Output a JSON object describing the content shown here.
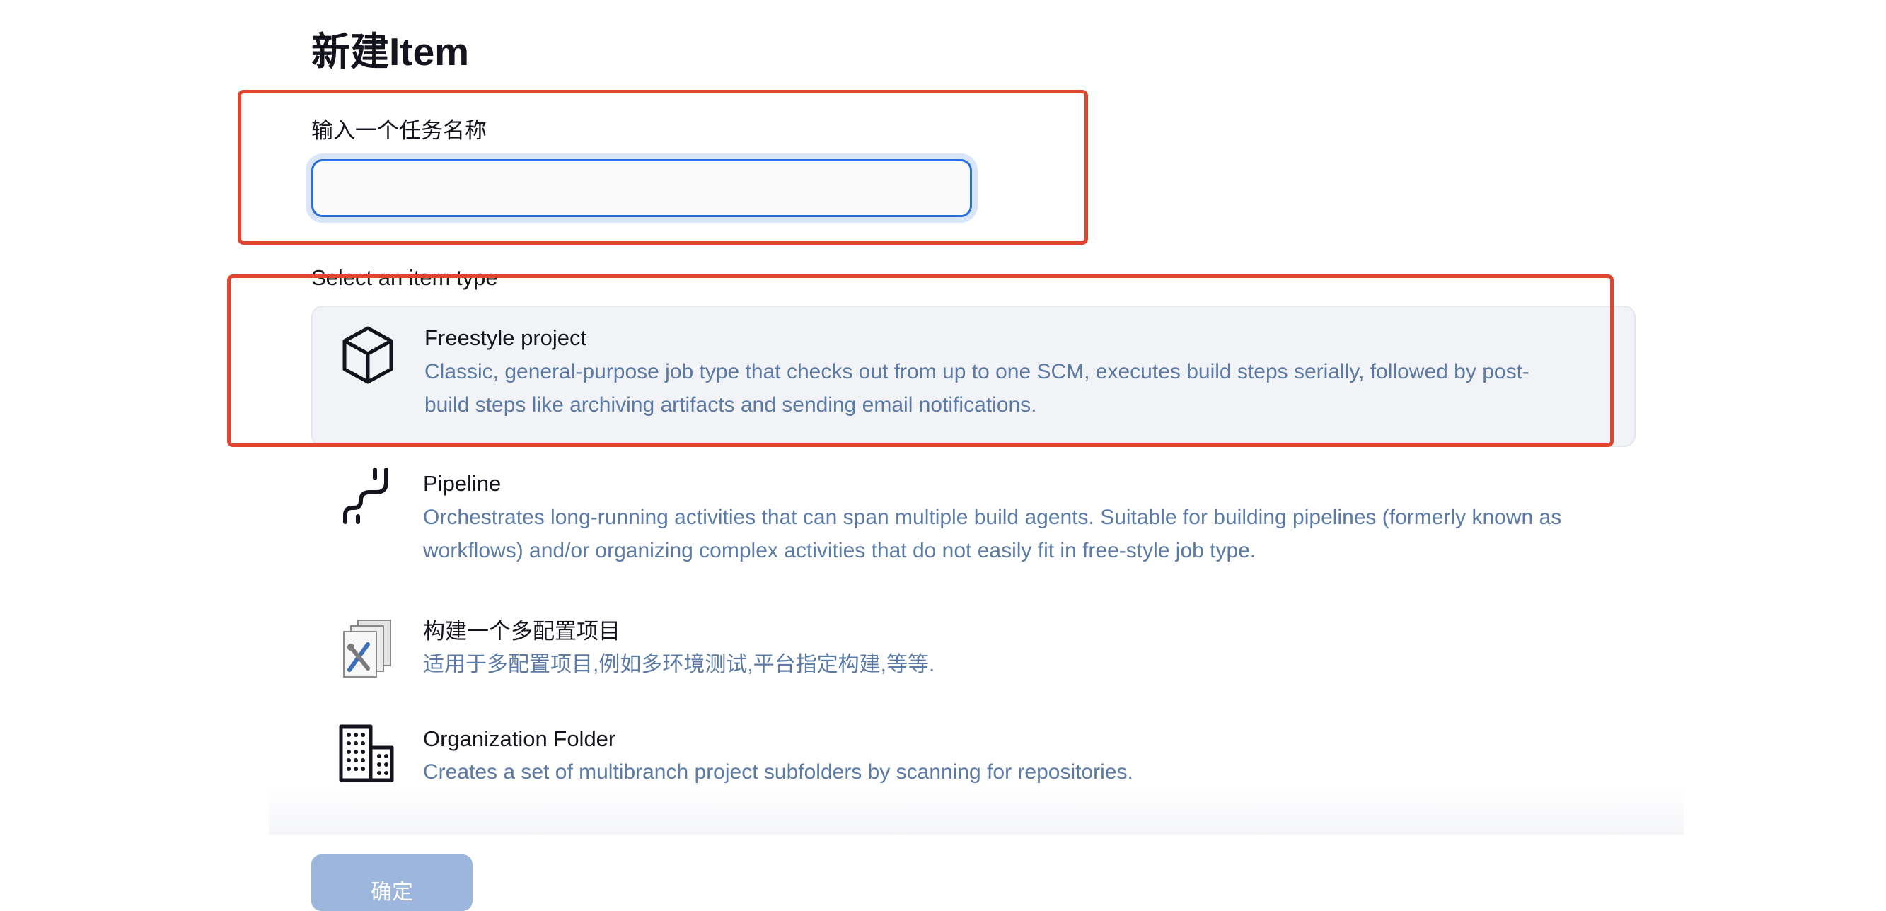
{
  "page": {
    "title": "新建Item"
  },
  "name_field": {
    "label": "输入一个任务名称",
    "value": "",
    "placeholder": ""
  },
  "item_types": {
    "label": "Select an item type",
    "items": [
      {
        "name": "Freestyle project",
        "description": "Classic, general-purpose job type that checks out from up to one SCM, executes build steps serially, followed by post-build steps like archiving artifacts and sending email notifications.",
        "icon": "freestyle-cube-icon",
        "selected": true
      },
      {
        "name": "Pipeline",
        "description": "Orchestrates long-running activities that can span multiple build agents. Suitable for building pipelines (formerly known as workflows) and/or organizing complex activities that do not easily fit in free-style job type.",
        "icon": "pipeline-icon",
        "selected": false
      },
      {
        "name": "构建一个多配置项目",
        "description": "适用于多配置项目,例如多环境测试,平台指定构建,等等.",
        "icon": "multi-config-tools-icon",
        "selected": false
      },
      {
        "name": "Organization Folder",
        "description": "Creates a set of multibranch project subfolders by scanning for repositories.",
        "icon": "organization-buildings-icon",
        "selected": false
      }
    ]
  },
  "actions": {
    "ok_label": "确定"
  },
  "colors": {
    "accent": "#2a6fdb",
    "annotation": "#e0452e",
    "description": "#5b7aa6",
    "selected_bg": "#f1f3f7",
    "button_bg": "#9db6de"
  }
}
